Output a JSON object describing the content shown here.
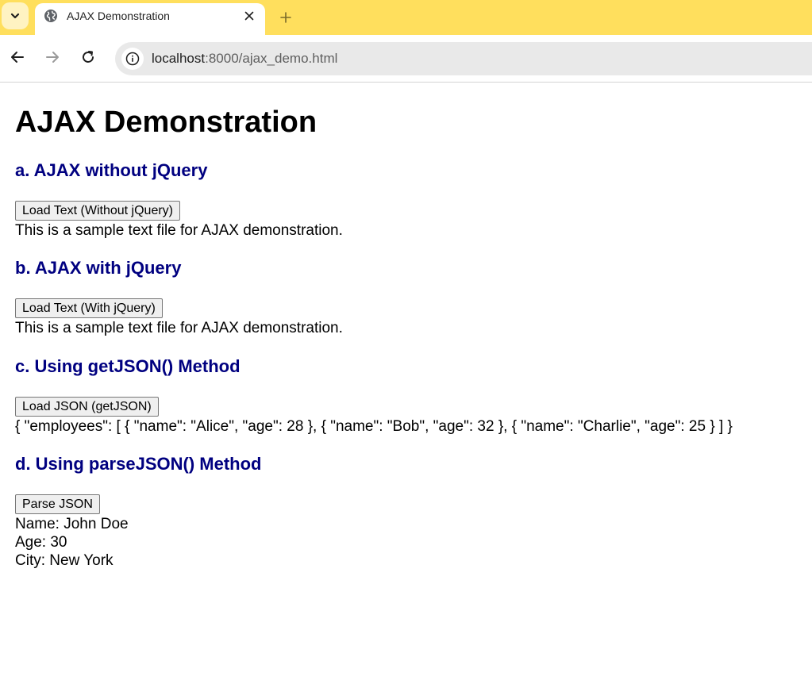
{
  "browser": {
    "tab": {
      "title": "AJAX Demonstration"
    },
    "address_bar": {
      "host": "localhost",
      "rest": ":8000/ajax_demo.html"
    },
    "accent_color": "#ffdf5d"
  },
  "page": {
    "title": "AJAX Demonstration",
    "heading_color": "#000080",
    "sections": [
      {
        "heading": "a. AJAX without jQuery",
        "button_label": "Load Text (Without jQuery)",
        "output_lines": [
          "This is a sample text file for AJAX demonstration."
        ]
      },
      {
        "heading": "b. AJAX with jQuery",
        "button_label": "Load Text (With jQuery)",
        "output_lines": [
          "This is a sample text file for AJAX demonstration."
        ]
      },
      {
        "heading": "c. Using getJSON() Method",
        "button_label": "Load JSON (getJSON)",
        "output_lines": [
          "{ \"employees\": [ { \"name\": \"Alice\", \"age\": 28 }, { \"name\": \"Bob\", \"age\": 32 }, { \"name\": \"Charlie\", \"age\": 25 } ] }"
        ]
      },
      {
        "heading": "d. Using parseJSON() Method",
        "button_label": "Parse JSON",
        "output_lines": [
          "Name: John Doe",
          "Age: 30",
          "City: New York"
        ]
      }
    ]
  }
}
